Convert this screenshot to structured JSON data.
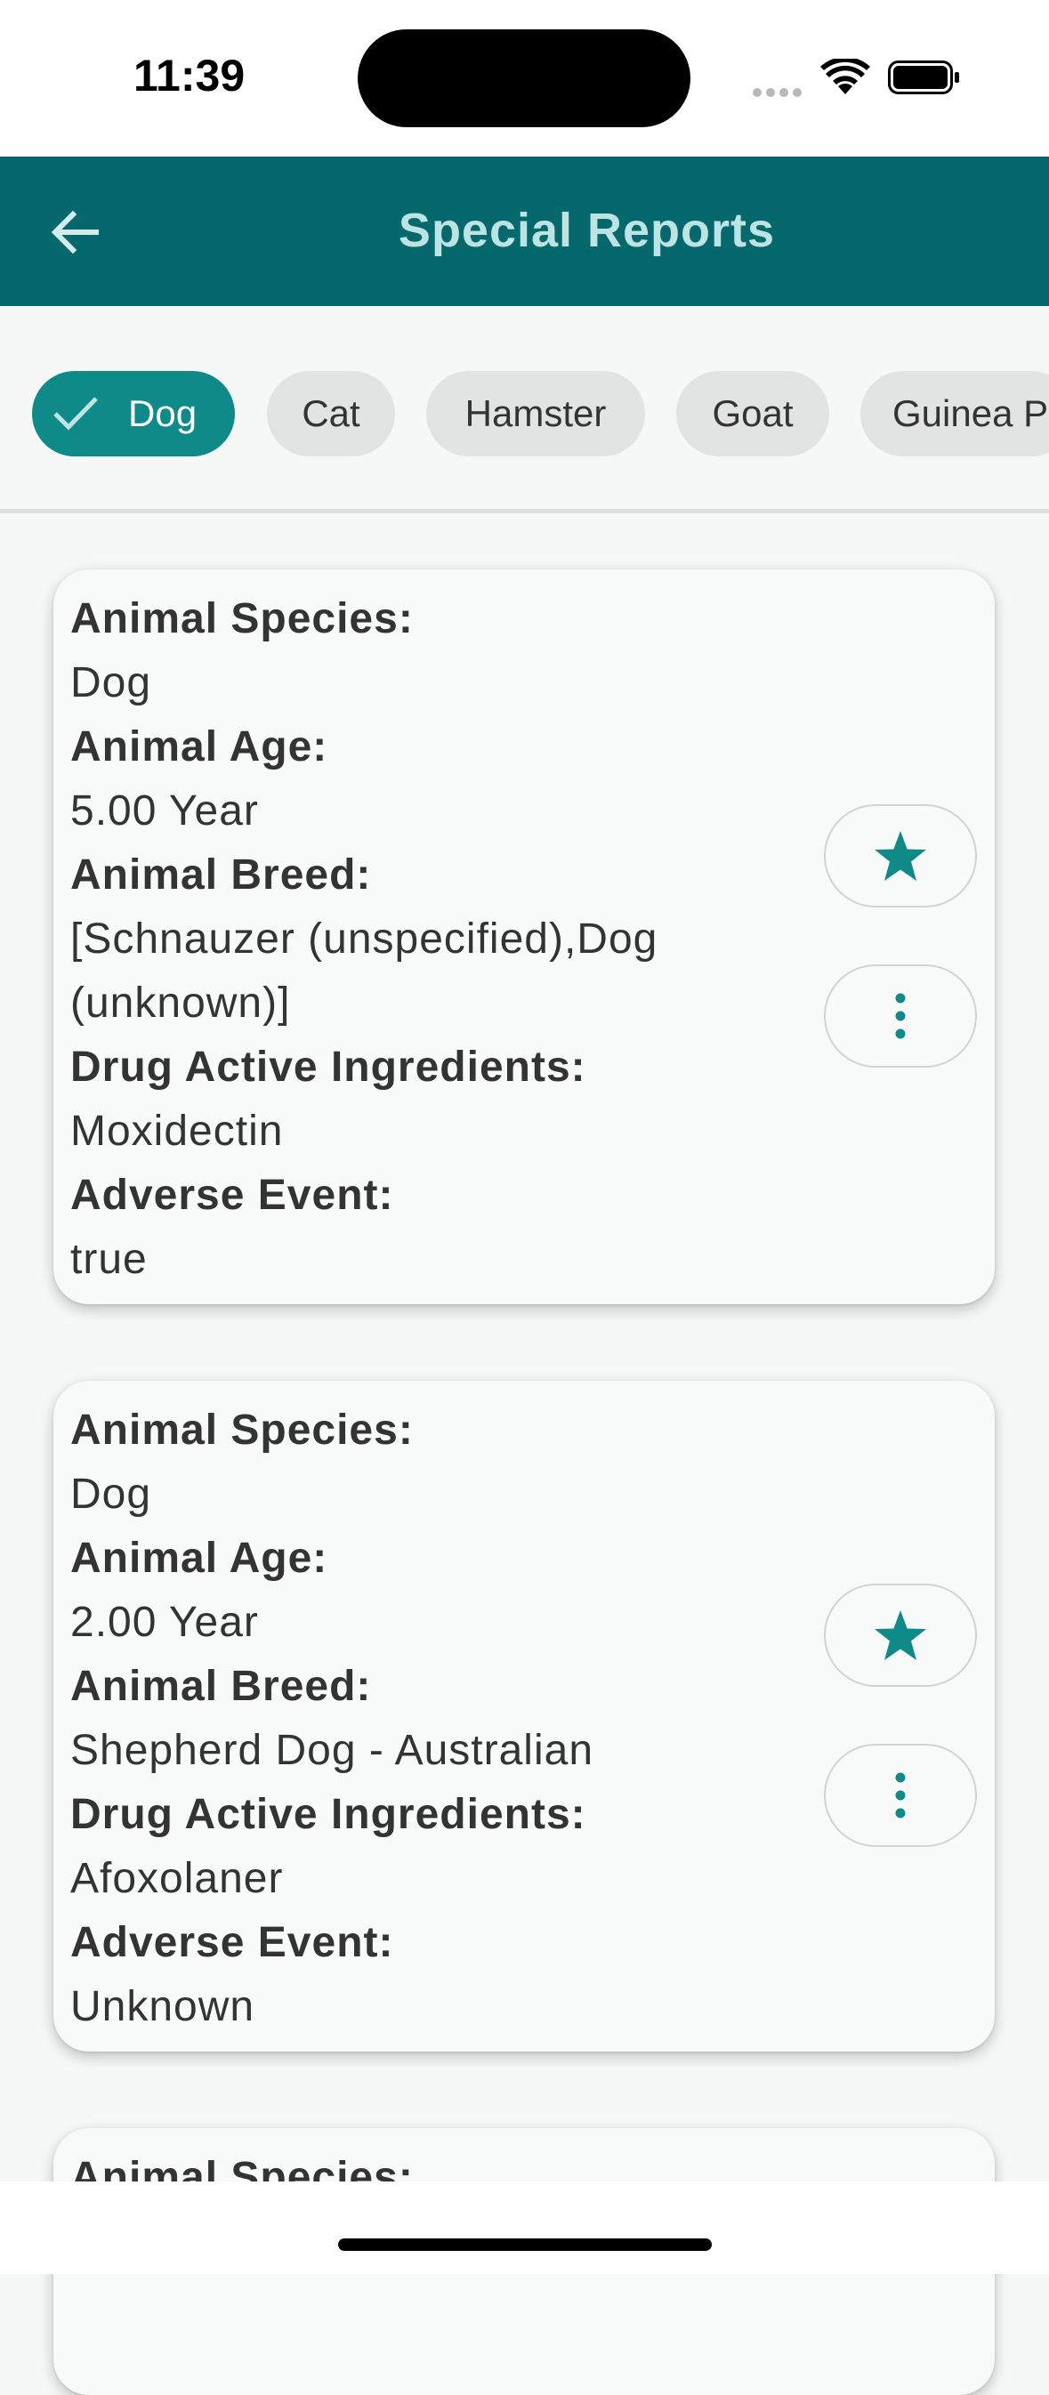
{
  "status_bar": {
    "time": "11:39"
  },
  "app_bar": {
    "title": "Special Reports"
  },
  "filters": {
    "chips": [
      "Dog",
      "Cat",
      "Hamster",
      "Goat",
      "Guinea Pig"
    ],
    "selected": "Dog"
  },
  "labels": {
    "species": "Animal Species:",
    "age": "Animal Age:",
    "breed": "Animal Breed:",
    "ingredients": "Drug Active Ingredients:",
    "adverse": "Adverse Event:"
  },
  "reports": [
    {
      "species": "Dog",
      "age": "5.00 Year",
      "breed_line1": "[Schnauzer (unspecified),Dog",
      "breed_line2": "(unknown)]",
      "ingredients": "Moxidectin",
      "adverse": "true"
    },
    {
      "species": "Dog",
      "age": "2.00 Year",
      "breed_line1": "Shepherd Dog - Australian",
      "ingredients": "Afoxolaner",
      "adverse": "Unknown"
    }
  ],
  "colors": {
    "primary": "#04686c",
    "accent": "#0e8a88"
  }
}
